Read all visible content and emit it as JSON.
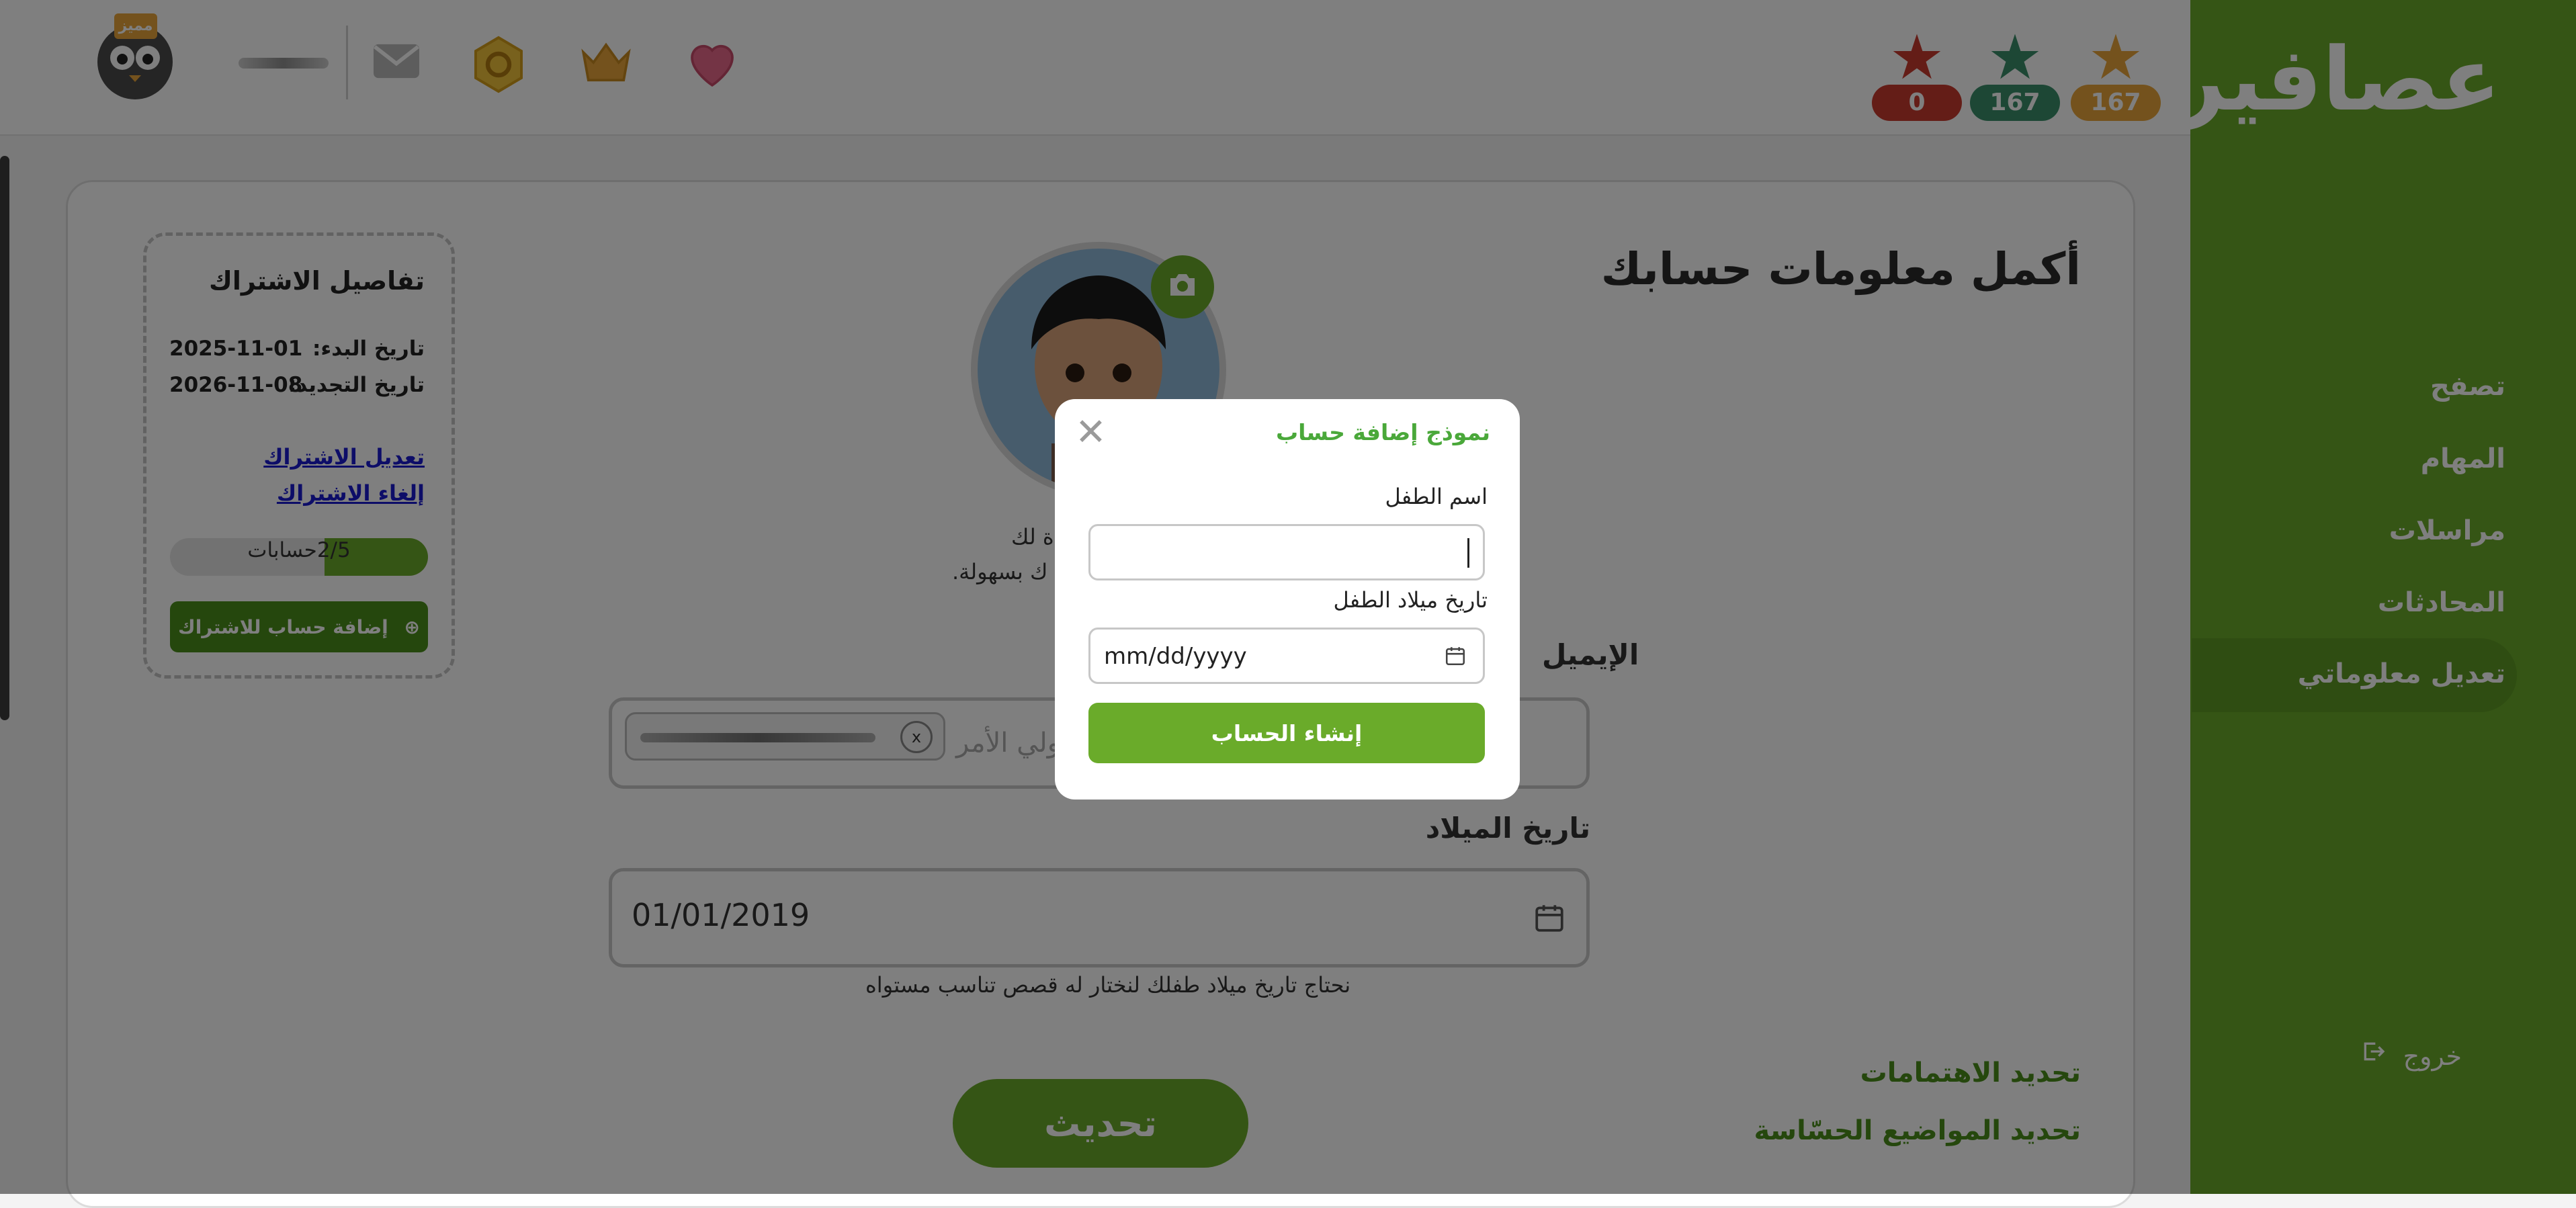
{
  "stats": [
    {
      "value": "167",
      "color": "#e8a53a",
      "icon": "star-gold-icon"
    },
    {
      "value": "167",
      "color": "#3a8f6a",
      "icon": "star-green-icon"
    },
    {
      "value": "0",
      "color": "#c93b2f",
      "icon": "star-red-icon"
    }
  ],
  "topbar": {
    "badge": "مميز"
  },
  "sidebar": {
    "logo": "عصافير",
    "items": [
      {
        "label": "تصفح"
      },
      {
        "label": "المهام"
      },
      {
        "label": "مراسلات"
      },
      {
        "label": "المحادثات"
      },
      {
        "label": "تعديل معلوماتي"
      }
    ],
    "logout": "خروج"
  },
  "main": {
    "title": "أكمل معلومات حسابك",
    "hint_line1": "ة لك",
    "hint_line2": "ك بسهولة.",
    "email_label": "الإيميل",
    "email_placeholder": "ولي الأمر",
    "chip_close": "x",
    "dob_label": "تاريخ الميلاد",
    "dob_value": "01/01/2019",
    "dob_hint": "نحتاج تاريخ ميلاد طفلك لنختار له قصص تناسب مستواه",
    "interests_link": "تحديد الاهتمامات",
    "sensitive_link": "تحديد المواضيع الحسّاسة",
    "update_button": "تحديث"
  },
  "subscription": {
    "title": "تفاصيل الاشتراك",
    "start_label": "تاريخ البدء:",
    "start_value": "2025-11-01",
    "renew_label": "تاريخ التجديد:",
    "renew_value": "2026-11-08",
    "edit_link": "تعديل الاشتراك",
    "cancel_link": "إلغاء الاشتراك",
    "accounts_text": "2/5حسابات",
    "accounts_used": 2,
    "accounts_total": 5,
    "add_button": "إضافة حساب للاشتراك"
  },
  "modal": {
    "title": "نموذج إضافة حساب",
    "name_label": "اسم الطفل",
    "name_value": "",
    "dob_label": "تاريخ ميلاد الطفل",
    "dob_placeholder": "mm/dd/yyyy",
    "submit": "إنشاء الحساب"
  }
}
